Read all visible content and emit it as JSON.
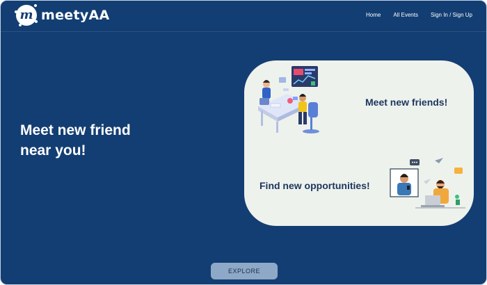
{
  "brand": {
    "name": "meetyAA",
    "logo_letter": "m"
  },
  "nav": {
    "items": [
      {
        "label": "Home"
      },
      {
        "label": "All Events"
      },
      {
        "label": "Sign In / Sign Up"
      }
    ]
  },
  "hero": {
    "heading_line1": "Meet new friend",
    "heading_line2": "near you!"
  },
  "features": {
    "first": "Meet new friends!",
    "second": "Find new opportunities!"
  },
  "cta": {
    "explore_label": "EXPLORE"
  },
  "colors": {
    "background": "#133e73",
    "card": "#eef2ec",
    "card_text": "#1b355e",
    "button": "#8ea8c7"
  },
  "icons": [
    "logo-icon",
    "office-team-illustration",
    "video-chat-illustration"
  ]
}
